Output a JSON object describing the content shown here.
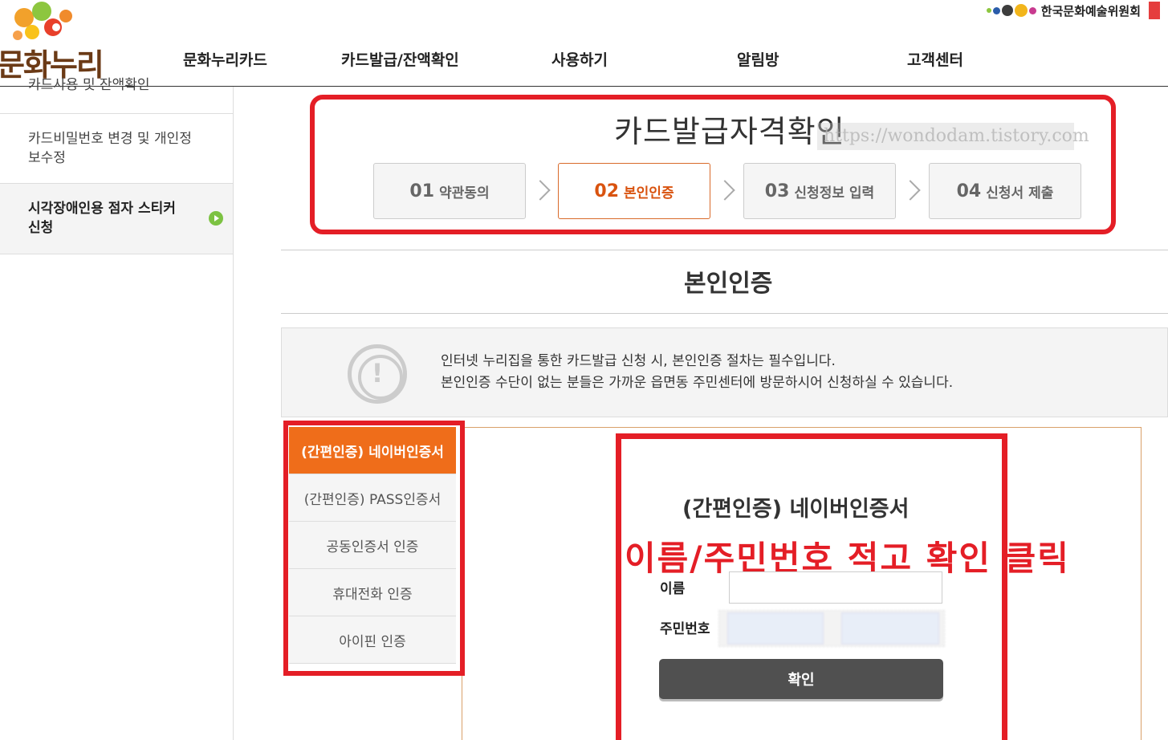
{
  "header": {
    "logo_text": "문화누리",
    "nav": [
      "문화누리카드",
      "카드발급/잔액확인",
      "사용하기",
      "알림방",
      "고객센터"
    ],
    "org_name": "한국문화예술위원회"
  },
  "sidebar": {
    "items": [
      {
        "label": "카드사용 및 잔액확인"
      },
      {
        "label": "카드비밀번호 변경 및 개인정보수정"
      },
      {
        "label": "시각장애인용 점자 스티커 신청"
      }
    ]
  },
  "steps": {
    "title": "카드발급자격확인",
    "watermark": "https://wondodam.tistory.com",
    "items": [
      {
        "num": "01",
        "label": "약관동의"
      },
      {
        "num": "02",
        "label": "본인인증"
      },
      {
        "num": "03",
        "label": "신청정보 입력"
      },
      {
        "num": "04",
        "label": "신청서 제출"
      }
    ]
  },
  "section": {
    "title": "본인인증"
  },
  "notice": {
    "line1": "인터넷 누리집을 통한 카드발급 신청 시, 본인인증 절차는 필수입니다.",
    "line2": "본인인증 수단이 없는 분들은 가까운 읍면동 주민센터에 방문하시어 신청하실 수 있습니다."
  },
  "auth_tabs": [
    {
      "label": "(간편인증) 네이버인증서"
    },
    {
      "label": "(간편인증) PASS인증서"
    },
    {
      "label": "공동인증서 인증"
    },
    {
      "label": "휴대전화 인증"
    },
    {
      "label": "아이핀 인증"
    }
  ],
  "form": {
    "title": "(간편인증) 네이버인증서",
    "annotation": "이름/주민번호 적고 확인 클릭",
    "name_label": "이름",
    "rrn_label": "주민번호",
    "confirm_label": "확인"
  },
  "colors": {
    "accent_orange": "#ef6d1a",
    "highlight_red": "#e41e26",
    "button_dark": "#505050"
  }
}
